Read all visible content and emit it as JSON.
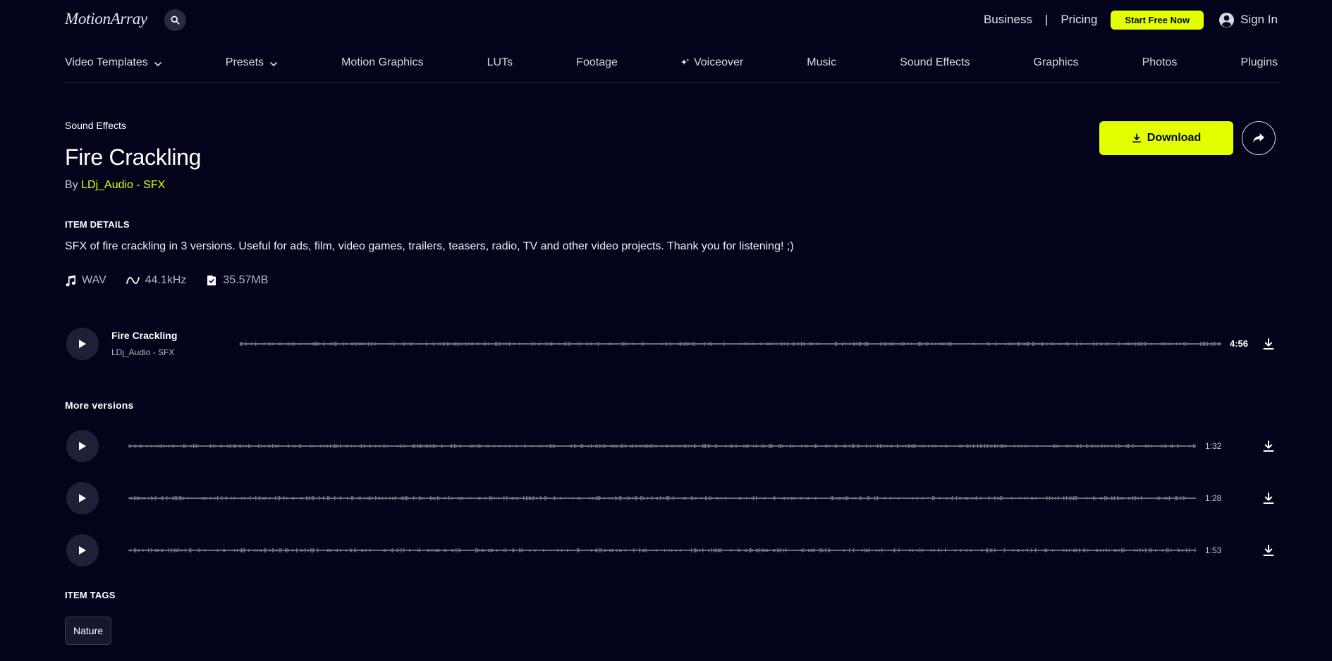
{
  "header": {
    "logo": "MotionArray",
    "links": {
      "business": "Business",
      "separator": "|",
      "pricing": "Pricing"
    },
    "start_button": "Start Free Now",
    "sign_in": "Sign In"
  },
  "nav": {
    "items": [
      {
        "label": "Video Templates",
        "dropdown": true
      },
      {
        "label": "Presets",
        "dropdown": true
      },
      {
        "label": "Motion Graphics"
      },
      {
        "label": "LUTs"
      },
      {
        "label": "Footage"
      },
      {
        "label": "Voiceover",
        "icon": "sparkle-icon"
      },
      {
        "label": "Music"
      },
      {
        "label": "Sound Effects"
      },
      {
        "label": "Graphics"
      },
      {
        "label": "Photos"
      },
      {
        "label": "Plugins"
      }
    ]
  },
  "item": {
    "breadcrumb": "Sound Effects",
    "title": "Fire Crackling",
    "by_prefix": "By ",
    "author": "LDj_Audio - SFX",
    "download_label": "Download",
    "details_heading": "ITEM DETAILS",
    "description": "SFX of fire crackling in 3 versions. Useful for ads, film, video games, trailers, teasers, radio, TV and other video projects. Thank you for listening! ;)",
    "format": "WAV",
    "sample_rate": "44.1kHz",
    "file_size": "35.57MB"
  },
  "main_track": {
    "title": "Fire Crackling",
    "author": "LDj_Audio - SFX",
    "duration": "4:56"
  },
  "versions": {
    "heading": "More versions",
    "items": [
      {
        "duration": "1:32"
      },
      {
        "duration": "1:28"
      },
      {
        "duration": "1:53"
      }
    ]
  },
  "tags": {
    "heading": "ITEM TAGS",
    "items": [
      "Nature"
    ]
  },
  "colors": {
    "background": "#03041b",
    "accent": "#e4ff00",
    "waveform": "#6b6d7d"
  }
}
